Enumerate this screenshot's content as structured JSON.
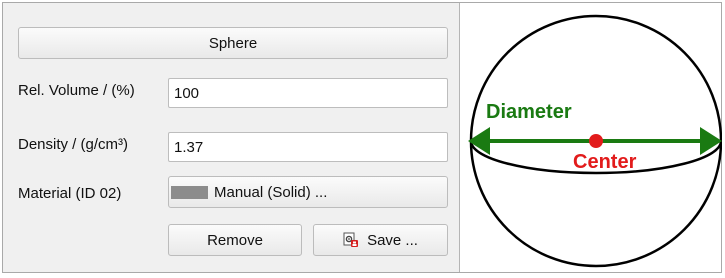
{
  "shape_button": "Sphere",
  "fields": {
    "rel_volume_label": "Rel. Volume / (%)",
    "rel_volume_value": "100",
    "density_label": "Density / (g/cm³)",
    "density_value": "1.37",
    "material_label": "Material (ID 02)",
    "material_button": "Manual (Solid) ...",
    "material_swatch_color": "#8c8c8c"
  },
  "actions": {
    "remove_label": "Remove",
    "save_label": "Save ..."
  },
  "diagram": {
    "diameter_label": "Diameter",
    "center_label": "Center",
    "diameter_color": "#1a7a12",
    "center_color": "#e21b1b"
  }
}
